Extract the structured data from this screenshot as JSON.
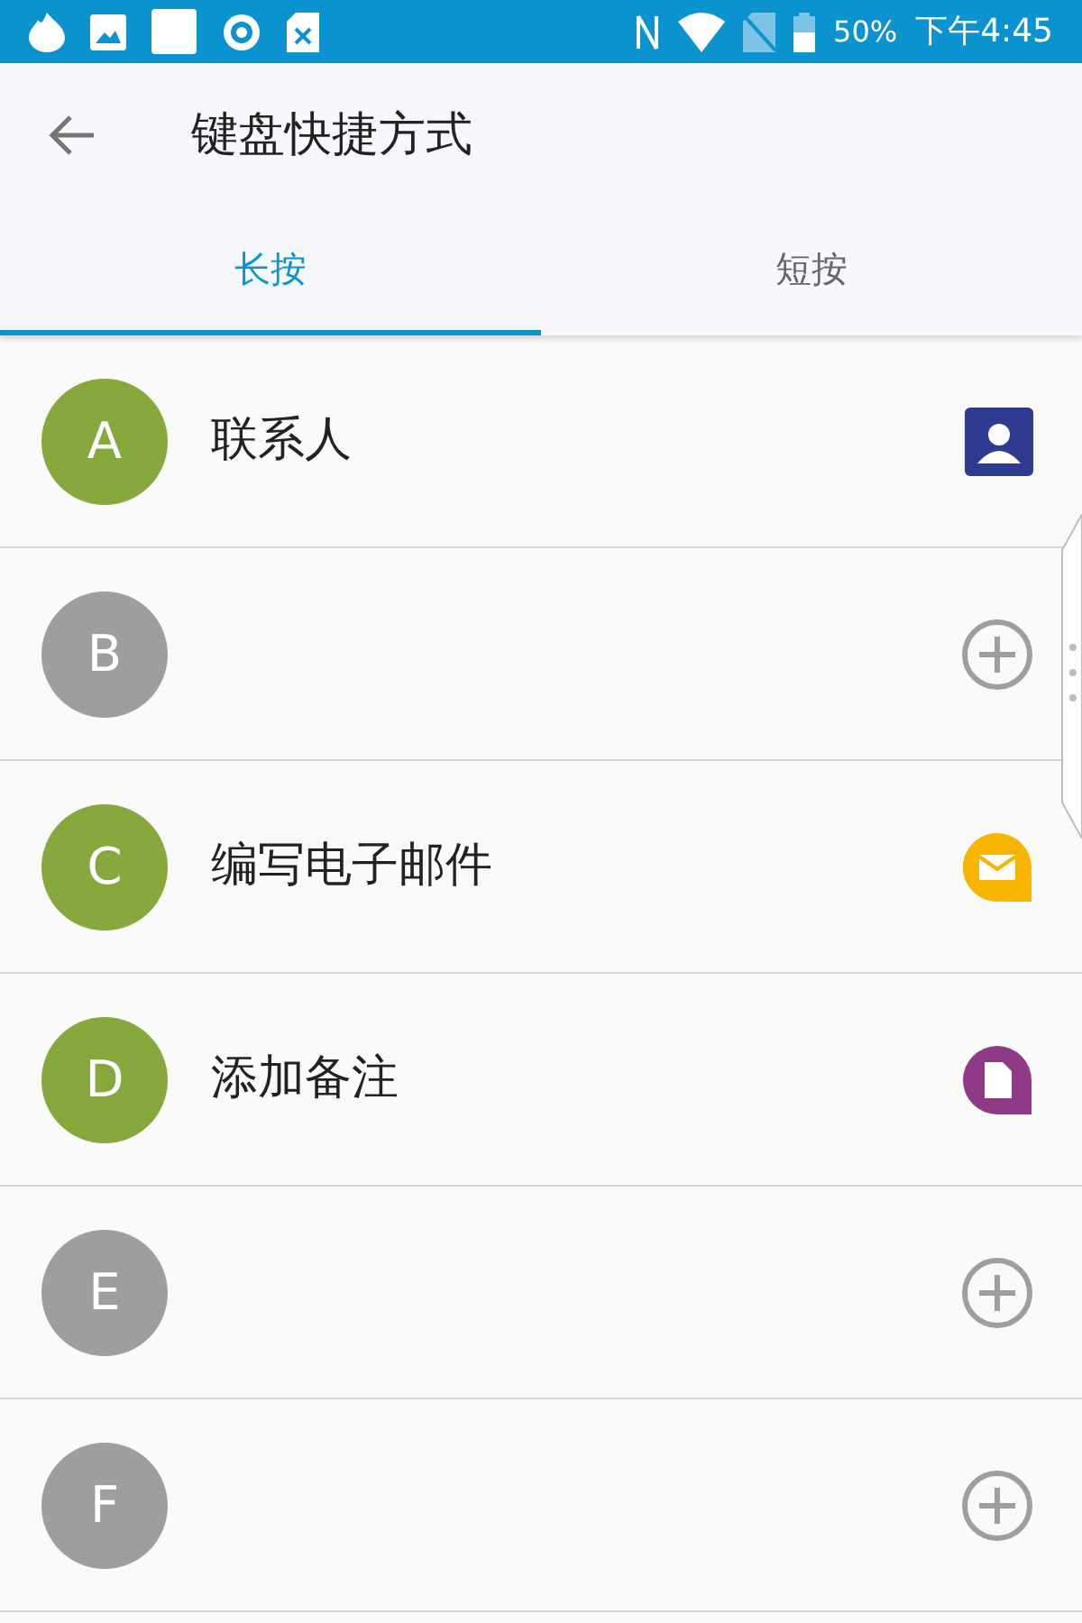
{
  "status_bar": {
    "battery": "50%",
    "time": "下午4:45"
  },
  "toolbar": {
    "title": "键盘快捷方式"
  },
  "tabs": [
    {
      "label": "长按",
      "selected": true
    },
    {
      "label": "短按",
      "selected": false
    }
  ],
  "shortcuts": [
    {
      "key": "A",
      "label": "联系人",
      "kind": "contact"
    },
    {
      "key": "B",
      "kind": "add"
    },
    {
      "key": "C",
      "label": "编写电子邮件",
      "kind": "email"
    },
    {
      "key": "D",
      "label": "添加备注",
      "kind": "note"
    },
    {
      "key": "E",
      "kind": "add"
    },
    {
      "key": "F",
      "kind": "add"
    }
  ]
}
